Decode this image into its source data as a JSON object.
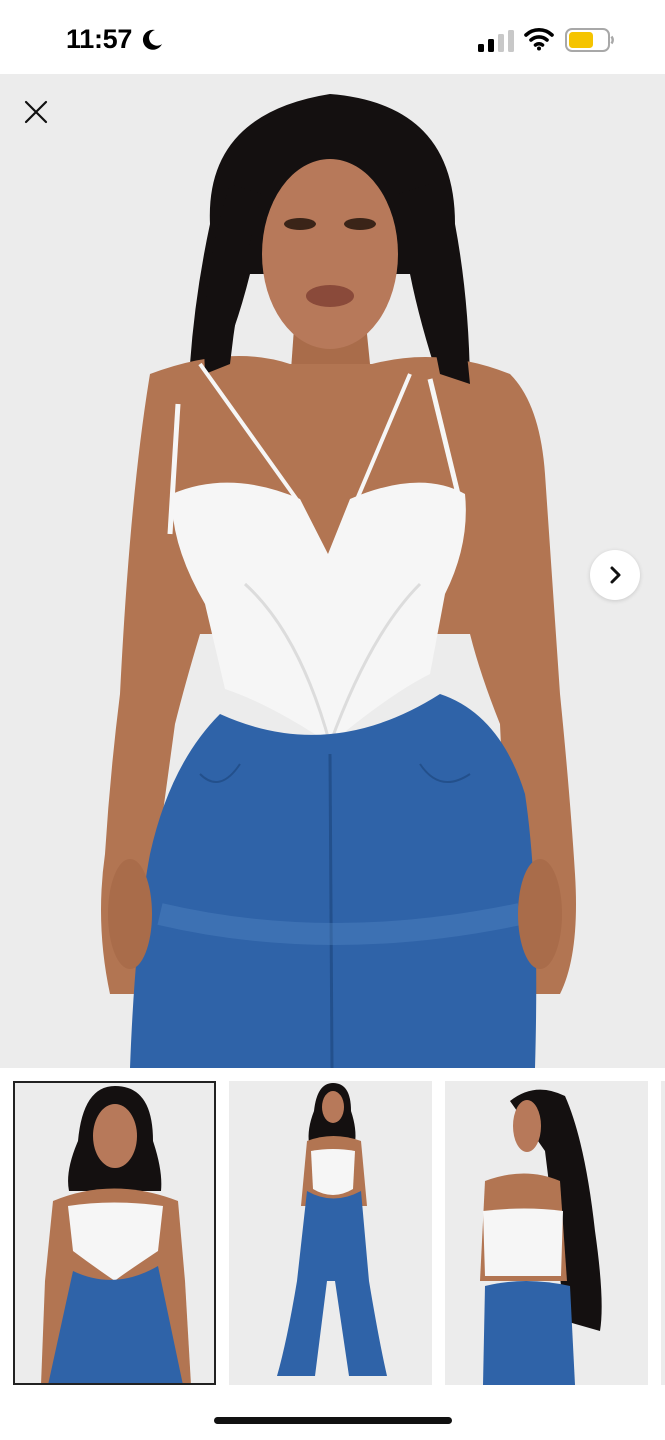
{
  "status_bar": {
    "time": "11:57",
    "moon_icon": "moon-icon",
    "signal_icon": "cellular-signal-icon",
    "wifi_icon": "wifi-icon",
    "battery_icon": "battery-icon",
    "battery_color": "#f5c400"
  },
  "gallery": {
    "close_icon": "close-icon",
    "next_icon": "chevron-right-icon",
    "main_image": "model-front-closeup",
    "thumbnails": [
      {
        "image": "model-front-waist",
        "selected": true
      },
      {
        "image": "model-full-body-flare-jeans",
        "selected": false
      },
      {
        "image": "model-back-view",
        "selected": false
      }
    ]
  },
  "colors": {
    "background": "#ececec",
    "denim": "#2f63a8",
    "top": "#f6f6f6",
    "hair": "#141010",
    "skin": "#b27552"
  }
}
